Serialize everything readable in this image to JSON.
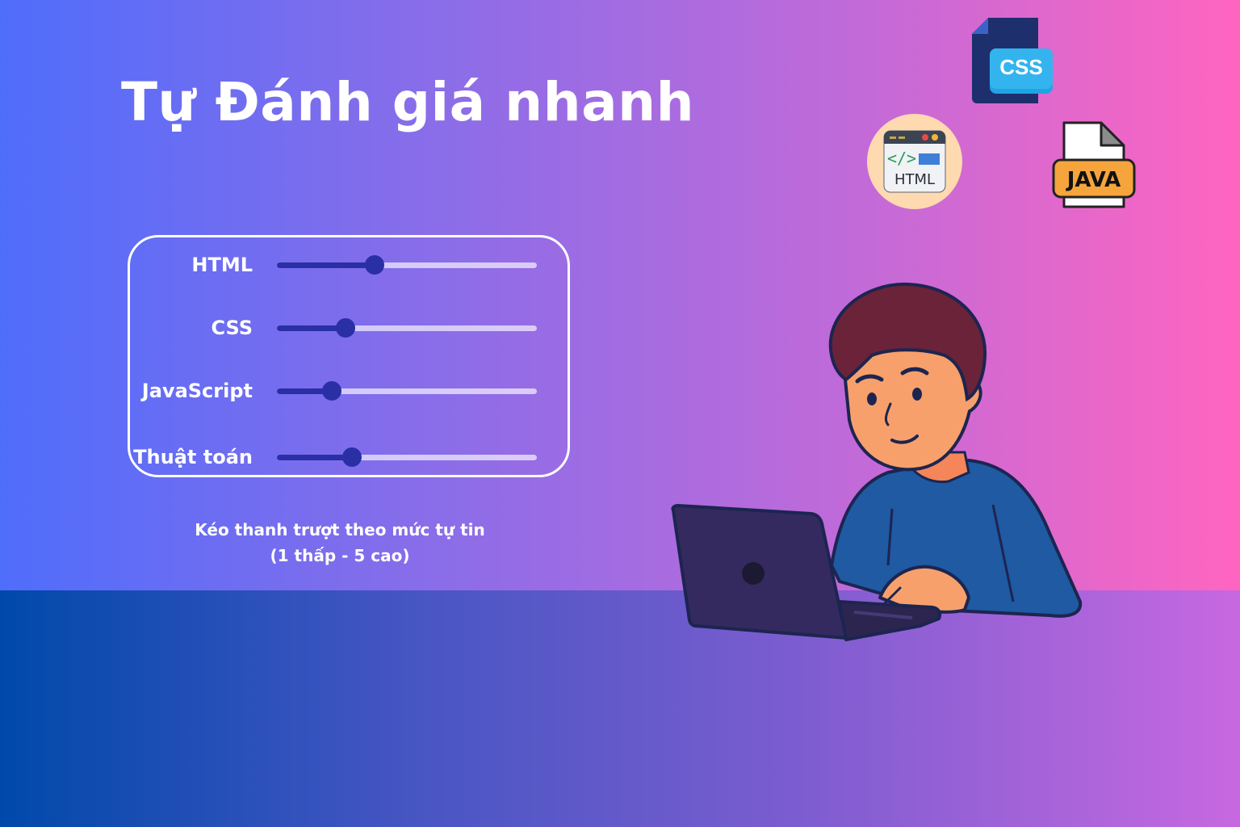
{
  "header": {
    "title": "Tự Đánh giá nhanh"
  },
  "sliders": [
    {
      "label": "HTML",
      "value": 2.5,
      "min": 1,
      "max": 5
    },
    {
      "label": "CSS",
      "value": 2.05,
      "min": 1,
      "max": 5
    },
    {
      "label": "JavaScript",
      "value": 1.85,
      "min": 1,
      "max": 5
    },
    {
      "label": "Thuật toán",
      "value": 2.15,
      "min": 1,
      "max": 5
    }
  ],
  "hint": {
    "line1": "Kéo thanh trượt theo mức tự tin",
    "line2": "(1 thấp - 5 cao)"
  },
  "icons": {
    "css_badge": "CSS",
    "html_badge": "HTML",
    "html_code_glyph": "</>",
    "java_badge": "JAVA"
  },
  "colors": {
    "slider_accent": "#2a2fa6",
    "gradient_left": "#4f6dfb",
    "gradient_right": "#ff65c0"
  }
}
